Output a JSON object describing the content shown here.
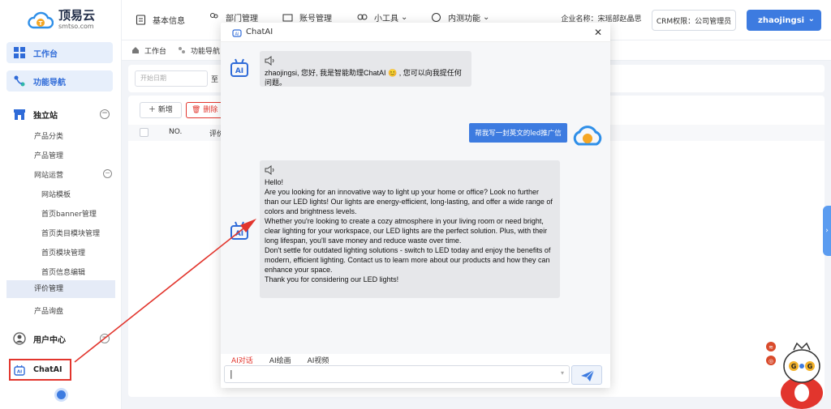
{
  "logo": {
    "name": "顶易云",
    "sub": "smtso.com"
  },
  "sidebar": {
    "workbench": "工作台",
    "func_nav": "功能导航",
    "site_group": "独立站",
    "site_items": [
      "产品分类",
      "产品管理",
      "网站运营"
    ],
    "site_ops_items": [
      "网站模板",
      "首页banner管理",
      "首页类目模块管理",
      "首页模块管理",
      "首页信息编辑"
    ],
    "review_mgmt": "评价管理",
    "product_inquiry": "产品询盘",
    "user_center": "用户中心",
    "chatai": "ChatAI"
  },
  "topbar": {
    "basic_info": "基本信息",
    "dept_mgmt": "部门管理",
    "account_mgmt": "账号管理",
    "tools": "小工具",
    "beta": "内测功能",
    "company_label": "企业名称：",
    "company_value": "宋瑶部赵晶思",
    "crm_label": "CRM权限：",
    "crm_value": "公司管理员",
    "username": "zhaojingsi"
  },
  "breadcrumb": {
    "home": "工作台",
    "func": "功能导航"
  },
  "filter": {
    "start_placeholder": "开始日期",
    "sep": "至"
  },
  "toolbar": {
    "add": "新增",
    "delete": "删除"
  },
  "table": {
    "col_no": "NO.",
    "col_review": "评价"
  },
  "chat": {
    "title": "ChatAI",
    "greeting": "zhaojingsi, 您好, 我是智能助理ChatAI 😊 , 您可以向我提任何问题。",
    "user_message": "帮我写一封英文的led推广信",
    "reply_lines": [
      "Hello!",
      "Are you looking for an innovative way to light up your home or office? Look no further than our LED lights! Our lights are energy-efficient, long-lasting, and offer a wide range of colors and brightness levels.",
      "Whether you're looking to create a cozy atmosphere in your living room or need bright, clear lighting for your workspace, our LED lights are the perfect solution. Plus, with their long lifespan, you'll save money and reduce waste over time.",
      "Don't settle for outdated lighting solutions - switch to LED today and enjoy the benefits of modern, efficient lighting. Contact us to learn more about our products and how they can enhance your space.",
      "Thank you for considering our LED lights!"
    ],
    "tabs": [
      "AI对话",
      "AI绘画",
      "AI视频"
    ]
  },
  "colors": {
    "accent": "#3d7be0",
    "danger": "#e2352d"
  },
  "icons": [
    "cloud-logo-icon",
    "grid-icon",
    "nav-icon",
    "store-icon",
    "user-icon",
    "chatai-icon",
    "speaker-icon",
    "send-icon",
    "close-icon",
    "mascot-icon"
  ]
}
